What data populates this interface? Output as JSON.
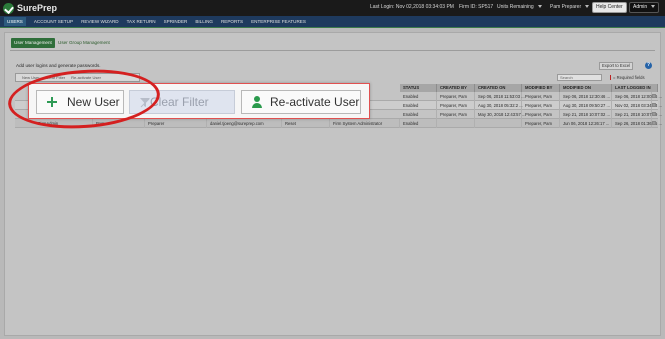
{
  "header": {
    "brand": "SurePrep",
    "last_login": "Last Login:  Nov 02,2018 03:34:03 PM",
    "firm_id": "Firm ID:  SP517",
    "units_label": "Units Remaining",
    "user_label": "Pam Preparer",
    "help_label": "Help Center",
    "admin_label": "Admin"
  },
  "nav": {
    "items": [
      "USERS",
      "ACCOUNT SETUP",
      "REVIEW WIZARD",
      "TAX RETURN",
      "SPRINDER",
      "BILLING",
      "REPORTS",
      "ENTERPRISE FEATURES"
    ]
  },
  "subtabs": {
    "user_management": "User Management",
    "user_group_management": "User Group Management"
  },
  "page": {
    "description": "Add user logins and generate passwords.",
    "export_label": "Export to Excel",
    "help_icon": "?",
    "search_placeholder": "Search",
    "required_fields": "= Required fields"
  },
  "toolbar_small": {
    "new_user": "New User",
    "clear_filter": "Clear Filter",
    "reactivate": "Re-activate User"
  },
  "callout": {
    "new_user": "New User",
    "clear_filter": "Clear Filter",
    "reactivate": "Re-activate User",
    "icons": [
      "plus-icon",
      "funnel-icon",
      "person-icon"
    ]
  },
  "grid": {
    "columns": [
      "STATUS",
      "CREATED BY",
      "CREATED ON",
      "MODIFIED BY",
      "MODIFIED ON",
      "LAST LOGGED IN"
    ],
    "rows": [
      [
        "Enabled",
        "Preparer, Pam",
        "Sep 06, 2018 11:53:03 ...",
        "Preparer, Pam",
        "Sep 06, 2018 12:30:46 ...",
        "Sep 06, 2018 12:00:36 ..."
      ],
      [
        "Enabled",
        "Preparer, Pam",
        "Aug 30, 2018 05:32:2 ...",
        "Preparer, Pam",
        "Aug 30, 2018 09:50:27 ...",
        "Nov 02, 2018 03:34:03 ..."
      ],
      [
        "Enabled",
        "Preparer, Pam",
        "May 30, 2018 12:43:57 ...",
        "Preparer, Pam",
        "Sep 21, 2018 10:07:02 ...",
        "Sep 21, 2018 10:07:19 ..."
      ],
      [
        "Enabled",
        "",
        "",
        "Preparer, Pam",
        "Jun 06, 2018 12:26:17 ...",
        "Sep 26, 2018 01:36:15 ..."
      ]
    ],
    "left_row": {
      "name": "FirmAdmin",
      "first": "Pam",
      "role": "Preparer",
      "email": "daniel.tjoeng@sureprep.com",
      "reset": "Reset",
      "group": "Firm System Administrator"
    }
  }
}
